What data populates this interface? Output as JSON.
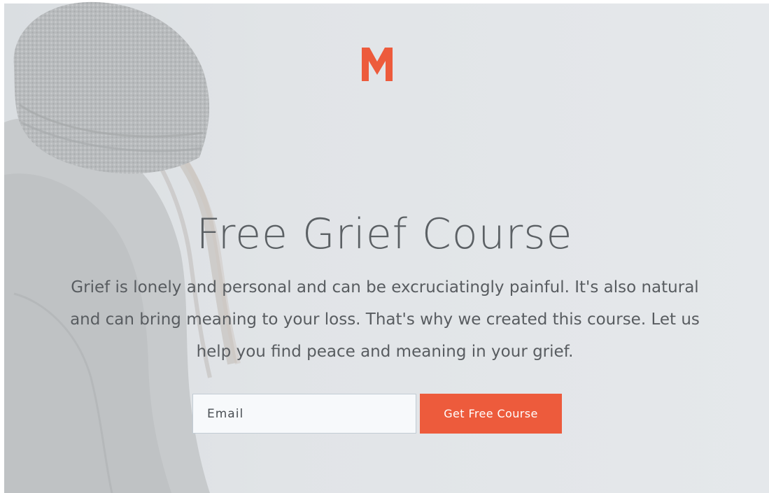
{
  "logo": {
    "letter": "M",
    "color": "#ed5b3c",
    "icon": "brand-m-logo"
  },
  "hero": {
    "title": "Free Grief Course",
    "description": "Grief is lonely and personal and can be excruciatingly painful. It's also natural and can bring meaning to your loss. That's why we created this course. Let us help you find peace and meaning in your grief."
  },
  "signup": {
    "email_placeholder": "Email",
    "email_value": "",
    "button_label": "Get Free Course"
  },
  "colors": {
    "accent": "#ed5b3c",
    "background": "#e4e7ea",
    "heading_text": "#5b6064",
    "body_text": "#585c60"
  }
}
